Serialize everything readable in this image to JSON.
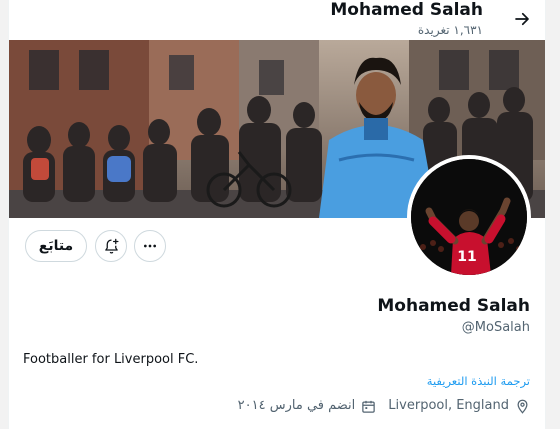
{
  "header": {
    "title": "Mohamed Salah",
    "tweet_count": "١,٦٣١ تغريدة",
    "back_icon": "arrow-right-icon"
  },
  "profile": {
    "name": "Mohamed Salah",
    "handle": "@MoSalah",
    "bio": "Footballer for Liverpool FC.",
    "translate_link": "ترجمة النبذة التعريفية",
    "location": "Liverpool, England",
    "joined": "انضم في مارس ٢٠١٤"
  },
  "actions": {
    "follow_label": "متابَع",
    "notifications_icon": "bell-plus-icon",
    "more_icon": "more-horizontal-icon"
  },
  "colors": {
    "accent": "#1d9bf0",
    "secondary_text": "#536471",
    "border": "#cfd9de",
    "jacket": "#4a9ee0"
  }
}
